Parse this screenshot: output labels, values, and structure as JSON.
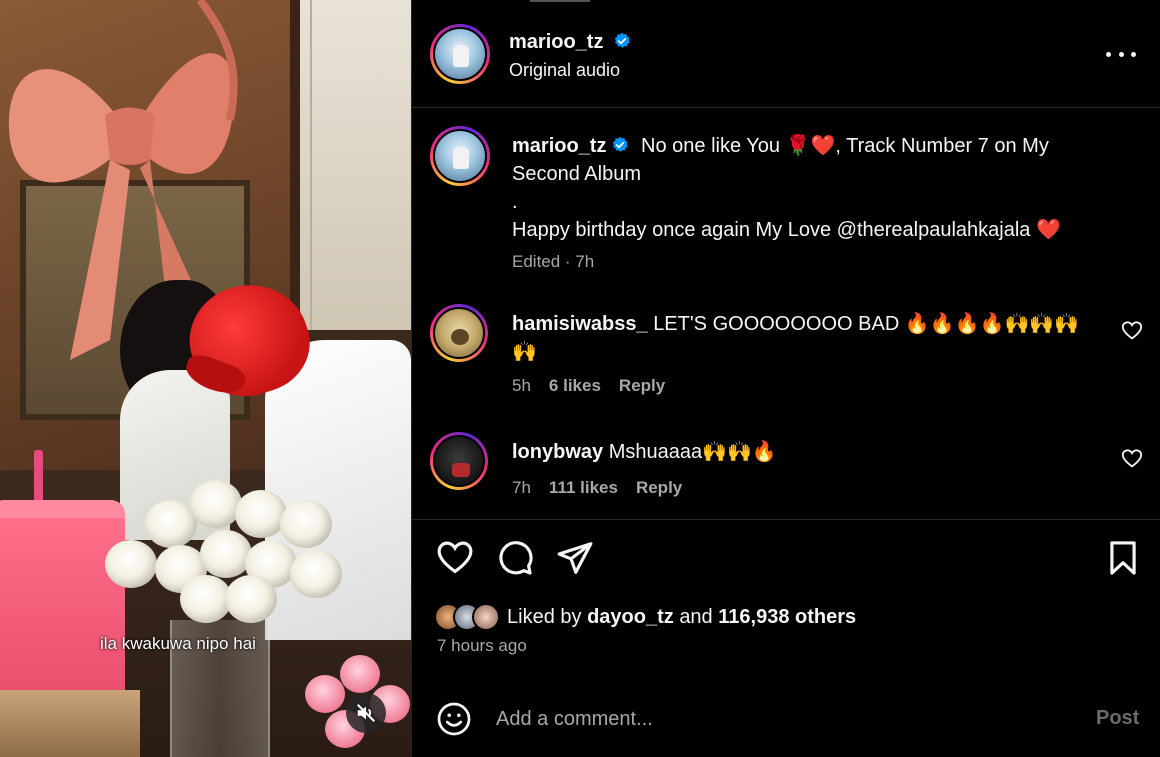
{
  "video": {
    "caption": "ila kwakuwa nipo hai"
  },
  "header": {
    "username": "marioo_tz",
    "subtitle": "Original audio"
  },
  "post": {
    "username": "marioo_tz",
    "caption_line1": "No one like You",
    "caption_line1_emoji": "🌹❤️",
    "caption_line1_rest": ", Track Number 7 on My",
    "caption_line2": "Second Album",
    "caption_dot": ".",
    "caption_line3": "Happy birthday once again My Love @therealpaulahkajala",
    "caption_line3_emoji": "❤️",
    "meta": "Edited · 7h"
  },
  "comments": [
    {
      "username": "hamisiwabss_",
      "text": "LET'S GOOOOOOOO BAD",
      "emoji": "🔥🔥🔥🔥🙌🙌🙌",
      "emoji_line2": "🙌",
      "time": "5h",
      "likes": "6 likes",
      "reply": "Reply"
    },
    {
      "username": "lonybway",
      "text": "Mshuaaaa",
      "emoji": "🙌🙌🔥",
      "time": "7h",
      "likes": "111 likes",
      "reply": "Reply"
    }
  ],
  "likes": {
    "prefix": "Liked by",
    "user": "dayoo_tz",
    "middle": "and",
    "others": "116,938 others"
  },
  "time_ago": "7 hours ago",
  "composer": {
    "placeholder": "Add a comment...",
    "post_label": "Post"
  },
  "colors": {
    "background": "#000000",
    "text_primary": "#f5f5f5",
    "text_secondary": "#a8a8a8",
    "verified_blue": "#0095f6",
    "divider": "#262626"
  },
  "icons": {
    "verified": "verified-badge-icon",
    "more": "more-options-icon",
    "like": "heart-icon",
    "comment": "comment-bubble-icon",
    "share": "paper-plane-icon",
    "save": "bookmark-icon",
    "emoji": "smiley-icon",
    "mute": "speaker-muted-icon"
  }
}
